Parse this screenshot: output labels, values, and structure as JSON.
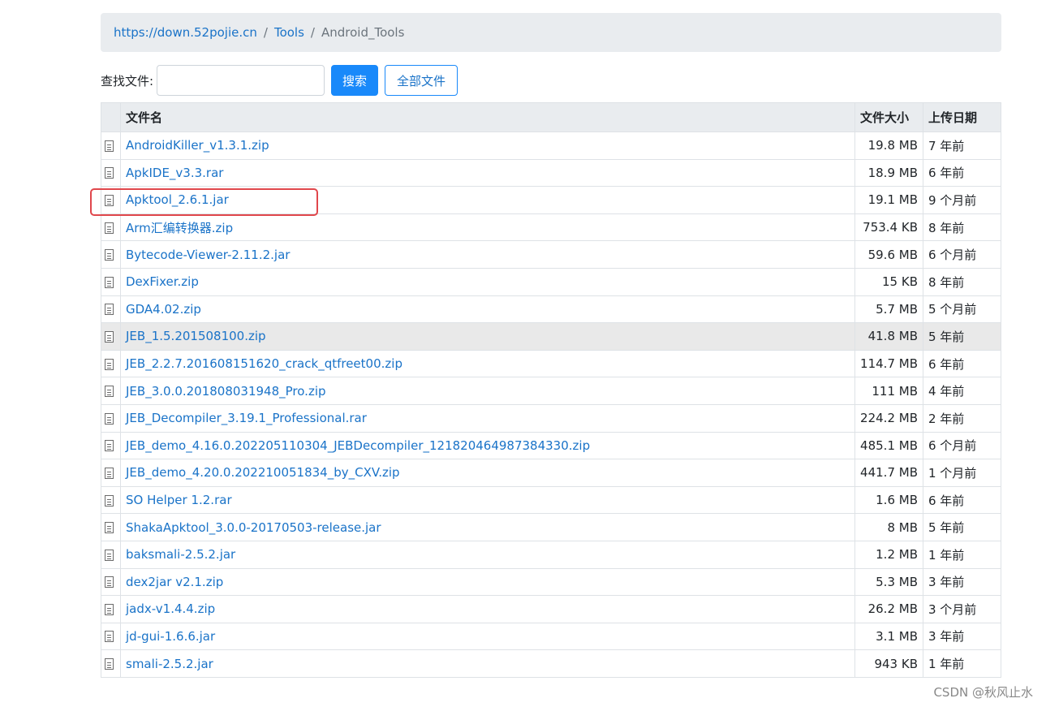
{
  "breadcrumb": {
    "items": [
      "https://down.52pojie.cn",
      "Tools"
    ],
    "current": "Android_Tools",
    "separator": "/"
  },
  "search": {
    "label": "查找文件:",
    "value": "",
    "placeholder": "",
    "search_button": "搜索",
    "all_files_button": "全部文件"
  },
  "table": {
    "headers": {
      "name": "文件名",
      "size": "文件大小",
      "date": "上传日期"
    },
    "rows": [
      {
        "name": "AndroidKiller_v1.3.1.zip",
        "size": "19.8 MB",
        "date": "7 年前"
      },
      {
        "name": "ApkIDE_v3.3.rar",
        "size": "18.9 MB",
        "date": "6 年前"
      },
      {
        "name": "Apktool_2.6.1.jar",
        "size": "19.1 MB",
        "date": "9 个月前"
      },
      {
        "name": "Arm汇编转换器.zip",
        "size": "753.4 KB",
        "date": "8 年前"
      },
      {
        "name": "Bytecode-Viewer-2.11.2.jar",
        "size": "59.6 MB",
        "date": "6 个月前"
      },
      {
        "name": "DexFixer.zip",
        "size": "15 KB",
        "date": "8 年前"
      },
      {
        "name": "GDA4.02.zip",
        "size": "5.7 MB",
        "date": "5 个月前"
      },
      {
        "name": "JEB_1.5.201508100.zip",
        "size": "41.8 MB",
        "date": "5 年前"
      },
      {
        "name": "JEB_2.2.7.201608151620_crack_qtfreet00.zip",
        "size": "114.7 MB",
        "date": "6 年前"
      },
      {
        "name": "JEB_3.0.0.201808031948_Pro.zip",
        "size": "111 MB",
        "date": "4 年前"
      },
      {
        "name": "JEB_Decompiler_3.19.1_Professional.rar",
        "size": "224.2 MB",
        "date": "2 年前"
      },
      {
        "name": "JEB_demo_4.16.0.202205110304_JEBDecompiler_121820464987384330.zip",
        "size": "485.1 MB",
        "date": "6 个月前"
      },
      {
        "name": "JEB_demo_4.20.0.202210051834_by_CXV.zip",
        "size": "441.7 MB",
        "date": "1 个月前"
      },
      {
        "name": "SO Helper 1.2.rar",
        "size": "1.6 MB",
        "date": "6 年前"
      },
      {
        "name": "ShakaApktool_3.0.0-20170503-release.jar",
        "size": "8 MB",
        "date": "5 年前"
      },
      {
        "name": "baksmali-2.5.2.jar",
        "size": "1.2 MB",
        "date": "1 年前"
      },
      {
        "name": "dex2jar v2.1.zip",
        "size": "5.3 MB",
        "date": "3 年前"
      },
      {
        "name": "jadx-v1.4.4.zip",
        "size": "26.2 MB",
        "date": "3 个月前"
      },
      {
        "name": "jd-gui-1.6.6.jar",
        "size": "3.1 MB",
        "date": "3 年前"
      },
      {
        "name": "smali-2.5.2.jar",
        "size": "943 KB",
        "date": "1 年前"
      }
    ]
  },
  "watermark": "CSDN @秋风止水",
  "colors": {
    "link": "#1a73c8",
    "primary": "#1989fa",
    "highlight_box": "#e0474c"
  }
}
